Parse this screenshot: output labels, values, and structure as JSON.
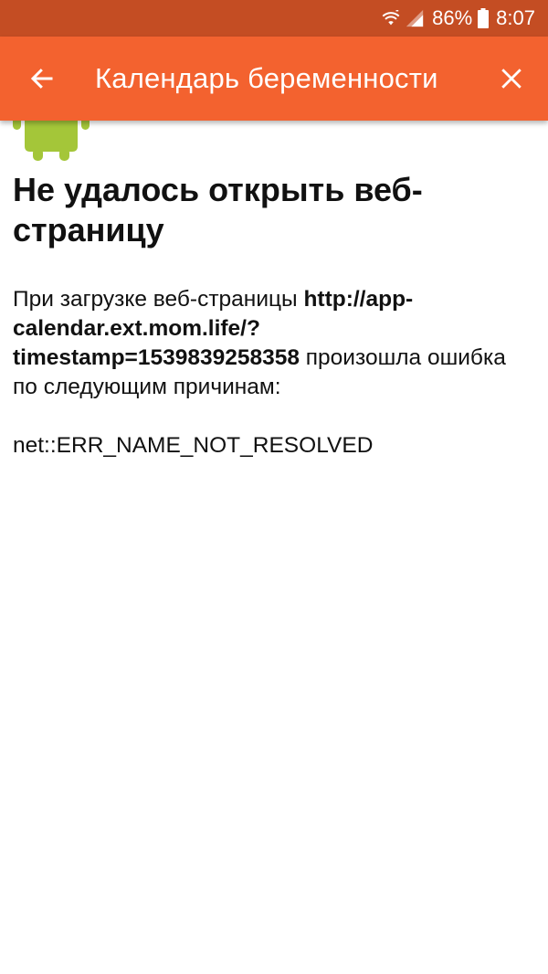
{
  "status_bar": {
    "battery_percent": "86%",
    "time": "8:07",
    "icons": [
      "wifi-icon",
      "signal-icon",
      "battery-icon"
    ]
  },
  "app_bar": {
    "title": "Календарь беременности",
    "back_icon": "arrow-left-icon",
    "close_icon": "close-icon"
  },
  "error_page": {
    "title": "Не удалось открыть веб-страницу",
    "desc_prefix": "При загрузке веб-страницы ",
    "url": "http://app-calendar.ext.mom.life/?timestamp=1539839258358",
    "desc_suffix": " произошла ошибка по следующим причинам:",
    "error_code": "net::ERR_NAME_NOT_RESOLVED"
  },
  "colors": {
    "status_bar": "#c44d23",
    "app_bar": "#f3622f",
    "android_green": "#a4c639",
    "text": "#111111"
  }
}
